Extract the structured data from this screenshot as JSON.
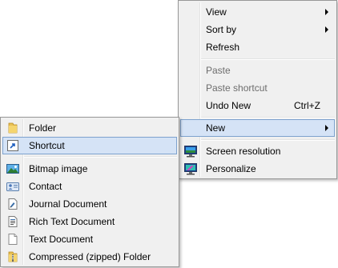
{
  "main_menu": {
    "items": [
      {
        "label": "View"
      },
      {
        "label": "Sort by"
      },
      {
        "label": "Refresh"
      },
      {
        "label": "Paste"
      },
      {
        "label": "Paste shortcut"
      },
      {
        "label": "Undo New",
        "shortcut": "Ctrl+Z"
      },
      {
        "label": "New"
      },
      {
        "label": "Screen resolution",
        "icon": "screen-resolution-icon"
      },
      {
        "label": "Personalize",
        "icon": "personalize-icon"
      }
    ]
  },
  "new_submenu": {
    "items": [
      {
        "label": "Folder",
        "icon": "folder-icon"
      },
      {
        "label": "Shortcut",
        "icon": "shortcut-icon"
      },
      {
        "label": "Bitmap image",
        "icon": "bitmap-image-icon"
      },
      {
        "label": "Contact",
        "icon": "contact-icon"
      },
      {
        "label": "Journal Document",
        "icon": "journal-document-icon"
      },
      {
        "label": "Rich Text Document",
        "icon": "rich-text-document-icon"
      },
      {
        "label": "Text Document",
        "icon": "text-document-icon"
      },
      {
        "label": "Compressed (zipped) Folder",
        "icon": "zipped-folder-icon"
      }
    ]
  },
  "colors": {
    "menu_background": "#f0f0f0",
    "highlight_background": "#d5e3f6",
    "highlight_border": "#7da2ce",
    "disabled_text": "#6d6d6d"
  }
}
